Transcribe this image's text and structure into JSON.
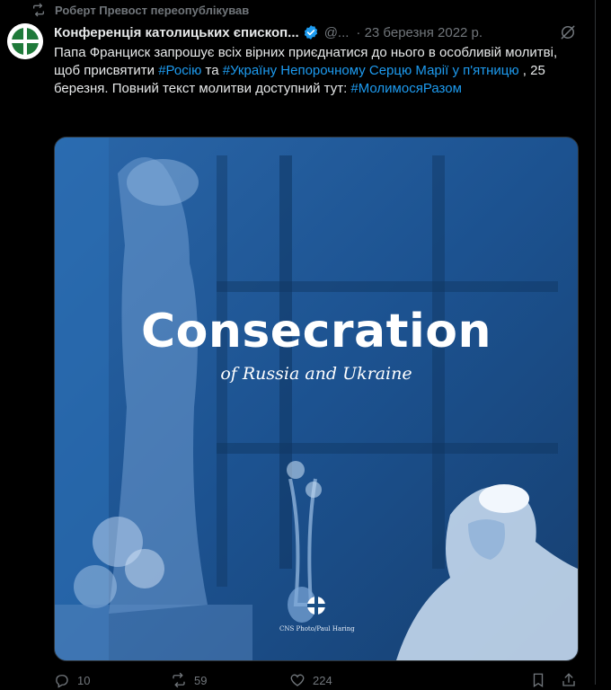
{
  "repost": {
    "text": "Роберт Превост переопублікував",
    "icon": "repost-icon"
  },
  "tweet": {
    "author": "Конференція католицьких єпископ...",
    "handle": "@...",
    "date": "· 23 березня 2022 р.",
    "text_parts": {
      "p1": "Папа Франциск запрошує всіх вірних приєднатися до нього в особливій молитві, щоб присвятити ",
      "tag1": "#Росію",
      "p2": " та ",
      "tag2": "#Україну Непорочному Серцю Марії",
      "p3": " ",
      "tag3": "у п'ятницю",
      "p4": " , 25 березня. Повний текст молитви доступний тут: ",
      "tag4": "#МолимосяРазом"
    }
  },
  "media": {
    "headline": "Consecration",
    "subline": "of Russia and Ukraine",
    "credit": "CNS Photo/Paul Haring"
  },
  "actions": {
    "replies": "10",
    "reposts": "59",
    "likes": "224",
    "icons": [
      "reply-icon",
      "repost-icon",
      "like-icon",
      "bookmark-icon",
      "share-icon"
    ]
  },
  "colors": {
    "accent": "#1d9bf0",
    "muted": "#71767b",
    "media_blue": "#1a4f86",
    "logo_green": "#1f7a3a"
  }
}
